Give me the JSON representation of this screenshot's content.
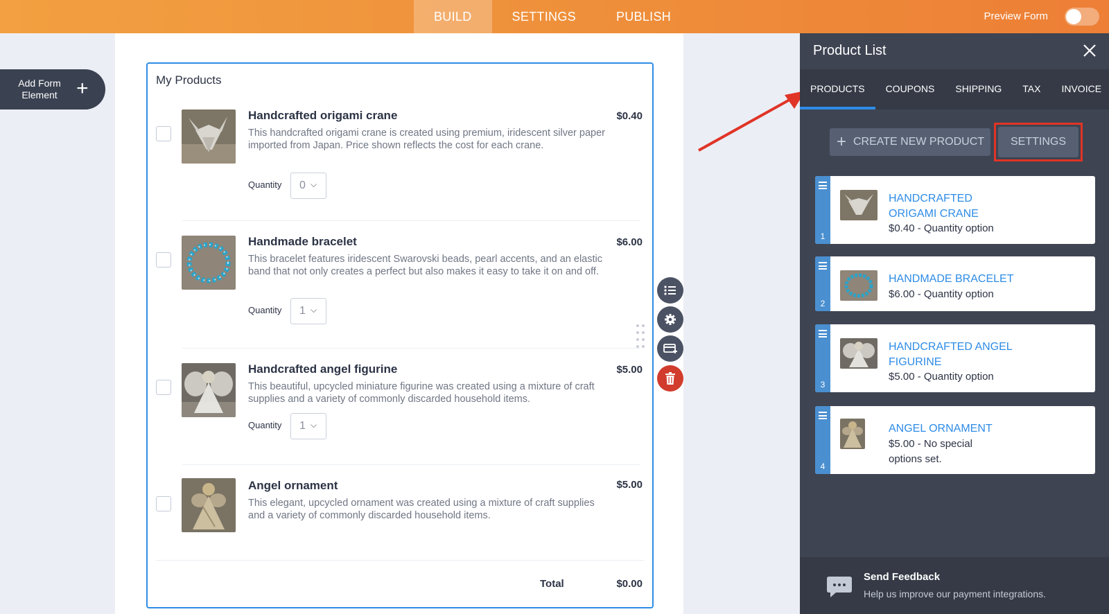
{
  "topbar": {
    "tabs": [
      {
        "label": "BUILD",
        "active": true
      },
      {
        "label": "SETTINGS",
        "active": false
      },
      {
        "label": "PUBLISH",
        "active": false
      }
    ],
    "preview_label": "Preview Form",
    "preview_on": false
  },
  "add_element": {
    "label": "Add Form Element",
    "icon": "plus-icon"
  },
  "form": {
    "title": "My Products",
    "products": [
      {
        "name": "Handcrafted origami crane",
        "price": "$0.40",
        "description": "This handcrafted origami crane is created using premium, iridescent silver paper imported from Japan. Price shown reflects the cost for each crane.",
        "quantity_label": "Quantity",
        "quantity": "0"
      },
      {
        "name": "Handmade bracelet",
        "price": "$6.00",
        "description": "This bracelet features iridescent Swarovski beads, pearl accents, and an elastic band that not only creates a perfect but also makes it easy to take it on and off.",
        "quantity_label": "Quantity",
        "quantity": "1"
      },
      {
        "name": "Handcrafted angel figurine",
        "price": "$5.00",
        "description": "This beautiful, upcycled miniature figurine was created using a mixture of craft supplies and a variety of commonly discarded household items.",
        "quantity_label": "Quantity",
        "quantity": "1"
      },
      {
        "name": "Angel ornament",
        "price": "$5.00",
        "description": "This elegant, upcycled ornament was created using a mixture of craft supplies and a variety of commonly discarded household items."
      }
    ],
    "total_label": "Total",
    "total_value": "$0.00"
  },
  "tools": [
    "list-icon",
    "gear-icon",
    "payment-card-icon",
    "trash-icon"
  ],
  "panel": {
    "title": "Product List",
    "tabs": [
      {
        "label": "PRODUCTS",
        "active": true
      },
      {
        "label": "COUPONS",
        "active": false
      },
      {
        "label": "SHIPPING",
        "active": false
      },
      {
        "label": "TAX",
        "active": false
      },
      {
        "label": "INVOICE",
        "active": false
      }
    ],
    "create_label": "CREATE NEW PRODUCT",
    "settings_label": "SETTINGS",
    "products": [
      {
        "index": "1",
        "name_lines": [
          "HANDCRAFTED",
          "ORIGAMI CRANE"
        ],
        "detail_lines": [
          "$0.40 - Quantity option"
        ]
      },
      {
        "index": "2",
        "name_lines": [
          "HANDMADE BRACELET"
        ],
        "detail_lines": [
          "$6.00 - Quantity option"
        ]
      },
      {
        "index": "3",
        "name_lines": [
          "HANDCRAFTED ANGEL",
          "FIGURINE"
        ],
        "detail_lines": [
          "$5.00 - Quantity option"
        ]
      },
      {
        "index": "4",
        "name_lines": [
          "ANGEL ORNAMENT"
        ],
        "detail_lines": [
          "$5.00 - No special",
          "options set."
        ]
      }
    ],
    "feedback_title": "Send Feedback",
    "feedback_subtitle": "Help us improve our payment integrations."
  },
  "colors": {
    "accent_orange": "#ef8f3a",
    "link_blue": "#2e8ce6",
    "annotation_red": "#e03426",
    "panel_bg": "#3e4452"
  }
}
